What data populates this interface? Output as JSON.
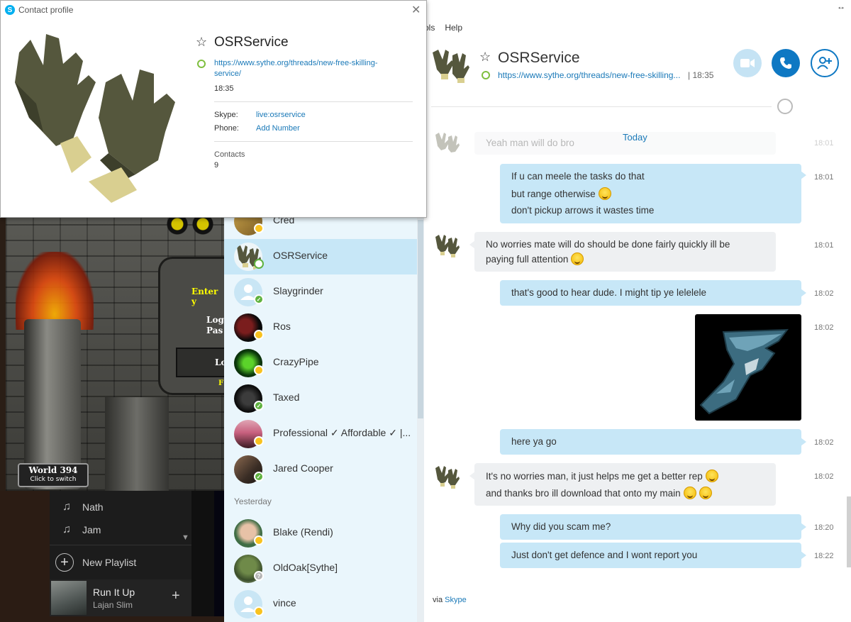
{
  "game": {
    "world_title": "World 394",
    "world_sub": "Click to switch",
    "login_fragment_1": "Enter y",
    "login_fragment_2": "Log",
    "login_fragment_3": "Pas",
    "login_fragment_4": "Lo",
    "login_fragment_5": "F"
  },
  "player": {
    "playlists": [
      "Nath",
      "Jam"
    ],
    "new_playlist_label": "New Playlist",
    "now_playing": {
      "title": "Run It Up",
      "artist": "Lajan Slim"
    }
  },
  "contacts": {
    "section_yesterday": "Yesterday",
    "items": [
      {
        "name": "Cred",
        "status": "away"
      },
      {
        "name": "OSRService",
        "status": "ring",
        "selected": true
      },
      {
        "name": "Slaygrinder",
        "status": "online"
      },
      {
        "name": "Ros",
        "status": "away"
      },
      {
        "name": "CrazyPipe",
        "status": "away"
      },
      {
        "name": "Taxed",
        "status": "online"
      },
      {
        "name": "Professional ✓ Affordable ✓ |...",
        "status": "away"
      },
      {
        "name": "Jared Cooper",
        "status": "online"
      },
      {
        "name": "Blake (Rendi)",
        "status": "away"
      },
      {
        "name": "OldOak[Sythe]",
        "status": "unknown"
      },
      {
        "name": "vince",
        "status": "away"
      }
    ]
  },
  "chat": {
    "menu": [
      "ols",
      "Help"
    ],
    "window_control": "↔",
    "contact_name": "OSRService",
    "mood_link": "https://www.sythe.org/threads/new-free-skilling...",
    "local_time": "| 18:35",
    "day_label": "Today",
    "faded_message": "Yeah man will do bro",
    "faded_time": "18:01",
    "messages": [
      {
        "dir": "out",
        "lines": [
          "If u can meele the tasks do that",
          "but range otherwise",
          "don't pickup arrows it wastes time"
        ],
        "time": "18:01"
      },
      {
        "dir": "in",
        "lines": [
          "No worries mate will do should be done fairly quickly ill be",
          "paying full attention"
        ],
        "time": "18:01"
      },
      {
        "dir": "out",
        "lines": [
          "that's good to hear dude. I might tip ye lelelele"
        ],
        "time": "18:02"
      },
      {
        "dir": "out",
        "image": true,
        "time": "18:02"
      },
      {
        "dir": "out",
        "lines": [
          "here ya go"
        ],
        "time": "18:02"
      },
      {
        "dir": "in",
        "lines": [
          "It's no worries man, it just helps me get a better rep",
          "and thanks bro ill download that onto my main"
        ],
        "time": "18:02"
      },
      {
        "dir": "out",
        "lines": [
          "Why did you scam me?"
        ],
        "time": "18:20"
      },
      {
        "dir": "out",
        "lines": [
          "Just don't get defence and I wont report you"
        ],
        "time": "18:22"
      }
    ],
    "via_prefix": "via",
    "via_link": "Skype"
  },
  "profile": {
    "window_title": "Contact profile",
    "close_glyph": "✕",
    "name": "OSRService",
    "mood": "https://www.sythe.org/threads/new-free-skilling-service/",
    "local_time": "18:35",
    "skype_label": "Skype:",
    "skype_value": "live:osrservice",
    "phone_label": "Phone:",
    "phone_value": "Add Number",
    "contacts_label": "Contacts",
    "contacts_count": "9"
  },
  "colors": {
    "accent": "#0e78c3",
    "link": "#1a79b8",
    "bubble_out": "#c7e7f7",
    "bubble_in": "#eef0f2",
    "status_online": "#5fb23f",
    "status_away": "#f8c21f"
  }
}
